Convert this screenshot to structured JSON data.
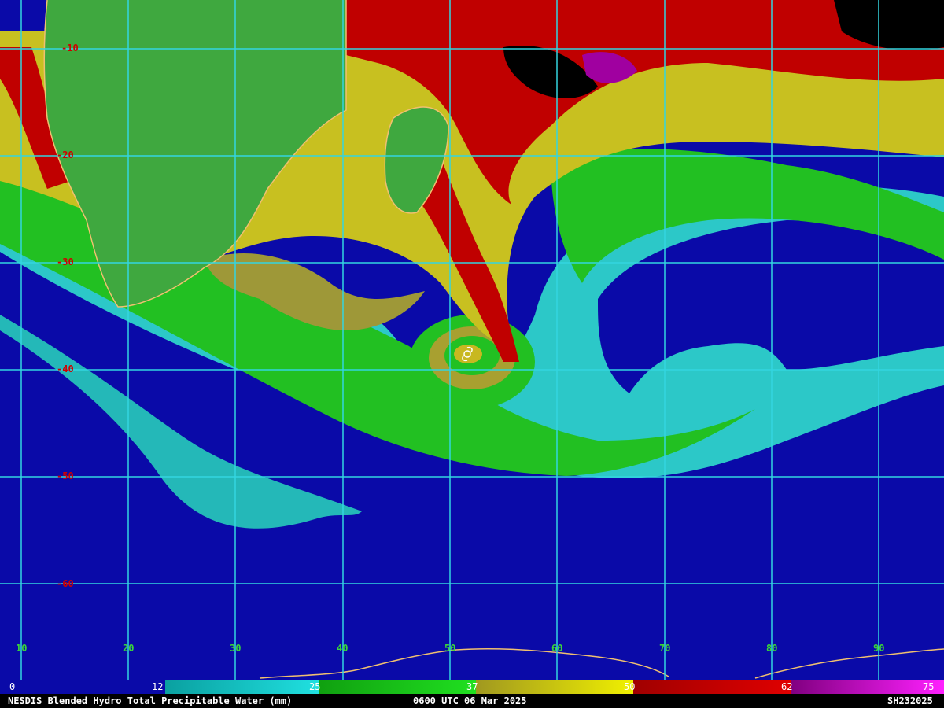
{
  "footer": {
    "product": "NESDIS Blended Hydro Total Precipitable Water (mm)",
    "time": "0600 UTC 06 Mar 2025",
    "storm_id": "SH232025"
  },
  "grid": {
    "lat_labels": [
      "-10",
      "-20",
      "-30",
      "-40",
      "-50",
      "-60"
    ],
    "lon_labels": [
      "10",
      "20",
      "30",
      "40",
      "50",
      "60",
      "70",
      "80",
      "90"
    ]
  },
  "colorbar": {
    "ticks": [
      "0",
      "12",
      "25",
      "37",
      "50",
      "62",
      "75"
    ],
    "colors": [
      "#0a0aa8",
      "#12a8a8",
      "#1fe01f",
      "#e6e600",
      "#c00000",
      "#d000d0"
    ]
  },
  "palette": {
    "ocean_dry": "#0a0aa8",
    "cyan": "#28d0d0",
    "green": "#20c020",
    "olive": "#a8a030",
    "yellow": "#e6e000",
    "red": "#c00000",
    "magenta": "#a000a0",
    "coast": "#f0c070",
    "grid": "#33d6e0"
  },
  "icons": {
    "storm_symbol": "tropical-cyclone-icon"
  }
}
